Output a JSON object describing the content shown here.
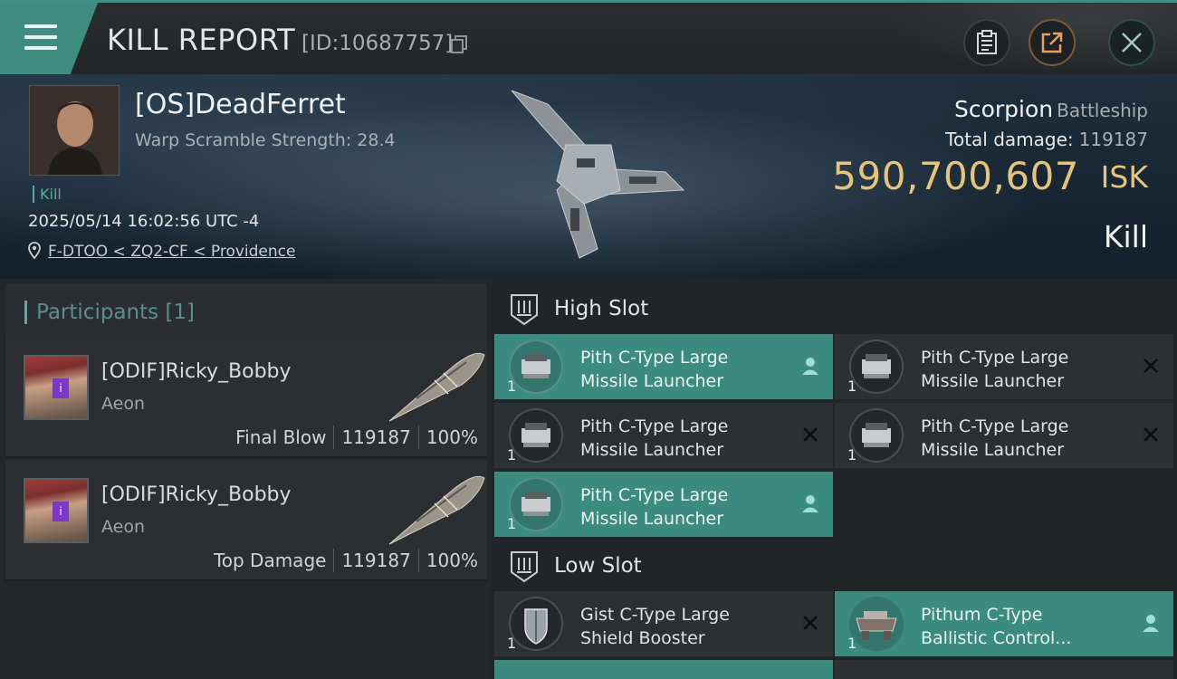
{
  "header": {
    "title": "KILL REPORT",
    "report_id": "[ID:10687757]"
  },
  "victim": {
    "name": "[OS]DeadFerret",
    "warp_scramble": "Warp Scramble Strength: 28.4",
    "kill_tag": "Kill",
    "date": "2025/05/14 16:02:56 UTC -4",
    "location": "F-DTOO < ZQ2-CF < Providence",
    "ship_name": "Scorpion",
    "ship_class": "Battleship",
    "total_damage_label": "Total damage:",
    "total_damage": "119187",
    "isk_value": "590,700,607",
    "isk_unit": "ISK",
    "result": "Kill"
  },
  "participants": {
    "header": "Participants [1]",
    "rows": [
      {
        "name": "[ODIF]Ricky_Bobby",
        "corp": "Aeon",
        "role": "Final Blow",
        "damage": "119187",
        "percent": "100%"
      },
      {
        "name": "[ODIF]Ricky_Bobby",
        "corp": "Aeon",
        "role": "Top Damage",
        "damage": "119187",
        "percent": "100%"
      }
    ]
  },
  "fitting": {
    "high_slot_label": "High Slot",
    "low_slot_label": "Low Slot",
    "high": [
      {
        "name_l1": "Pith C-Type Large",
        "name_l2": "Missile Launcher",
        "qty": "1",
        "status": "person-icon"
      },
      {
        "name_l1": "Pith C-Type Large",
        "name_l2": "Missile Launcher",
        "qty": "1",
        "status": "x-icon"
      },
      {
        "name_l1": "Pith C-Type Large",
        "name_l2": "Missile Launcher",
        "qty": "1",
        "status": "x-icon"
      },
      {
        "name_l1": "Pith C-Type Large",
        "name_l2": "Missile Launcher",
        "qty": "1",
        "status": "x-icon"
      },
      {
        "name_l1": "Pith C-Type Large",
        "name_l2": "Missile Launcher",
        "qty": "1",
        "status": "person-icon"
      }
    ],
    "low": [
      {
        "name_l1": "Gist C-Type Large",
        "name_l2": "Shield Booster",
        "qty": "1",
        "status": "x-icon"
      },
      {
        "name_l1": "Pithum C-Type",
        "name_l2": "Ballistic Control...",
        "qty": "1",
        "status": "person-icon"
      }
    ]
  },
  "colors": {
    "accent": "#3b8b80",
    "isk": "#e5c47c"
  }
}
